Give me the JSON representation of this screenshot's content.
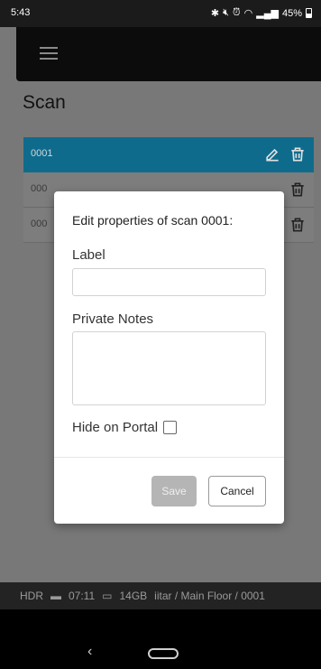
{
  "status_bar": {
    "time": "5:43",
    "battery": "45%"
  },
  "page": {
    "title": "Scan"
  },
  "scans": [
    {
      "label": "0001",
      "selected": true
    },
    {
      "label": "000",
      "selected": false
    },
    {
      "label": "000",
      "selected": false
    }
  ],
  "dialog": {
    "title": "Edit properties of scan 0001:",
    "label_field": {
      "label": "Label",
      "value": "",
      "placeholder": ""
    },
    "notes_field": {
      "label": "Private Notes",
      "value": "",
      "placeholder": ""
    },
    "hide_portal": {
      "label": "Hide on Portal",
      "checked": false
    },
    "save_label": "Save",
    "cancel_label": "Cancel"
  },
  "footer": {
    "hdr": "HDR",
    "duration": "07:11",
    "storage": "14GB",
    "path": "iitar / Main Floor / 0001"
  },
  "colors": {
    "selected_row": "#0f6b8c",
    "overlay": "#787878",
    "save_disabled": "#b5b5b5"
  }
}
